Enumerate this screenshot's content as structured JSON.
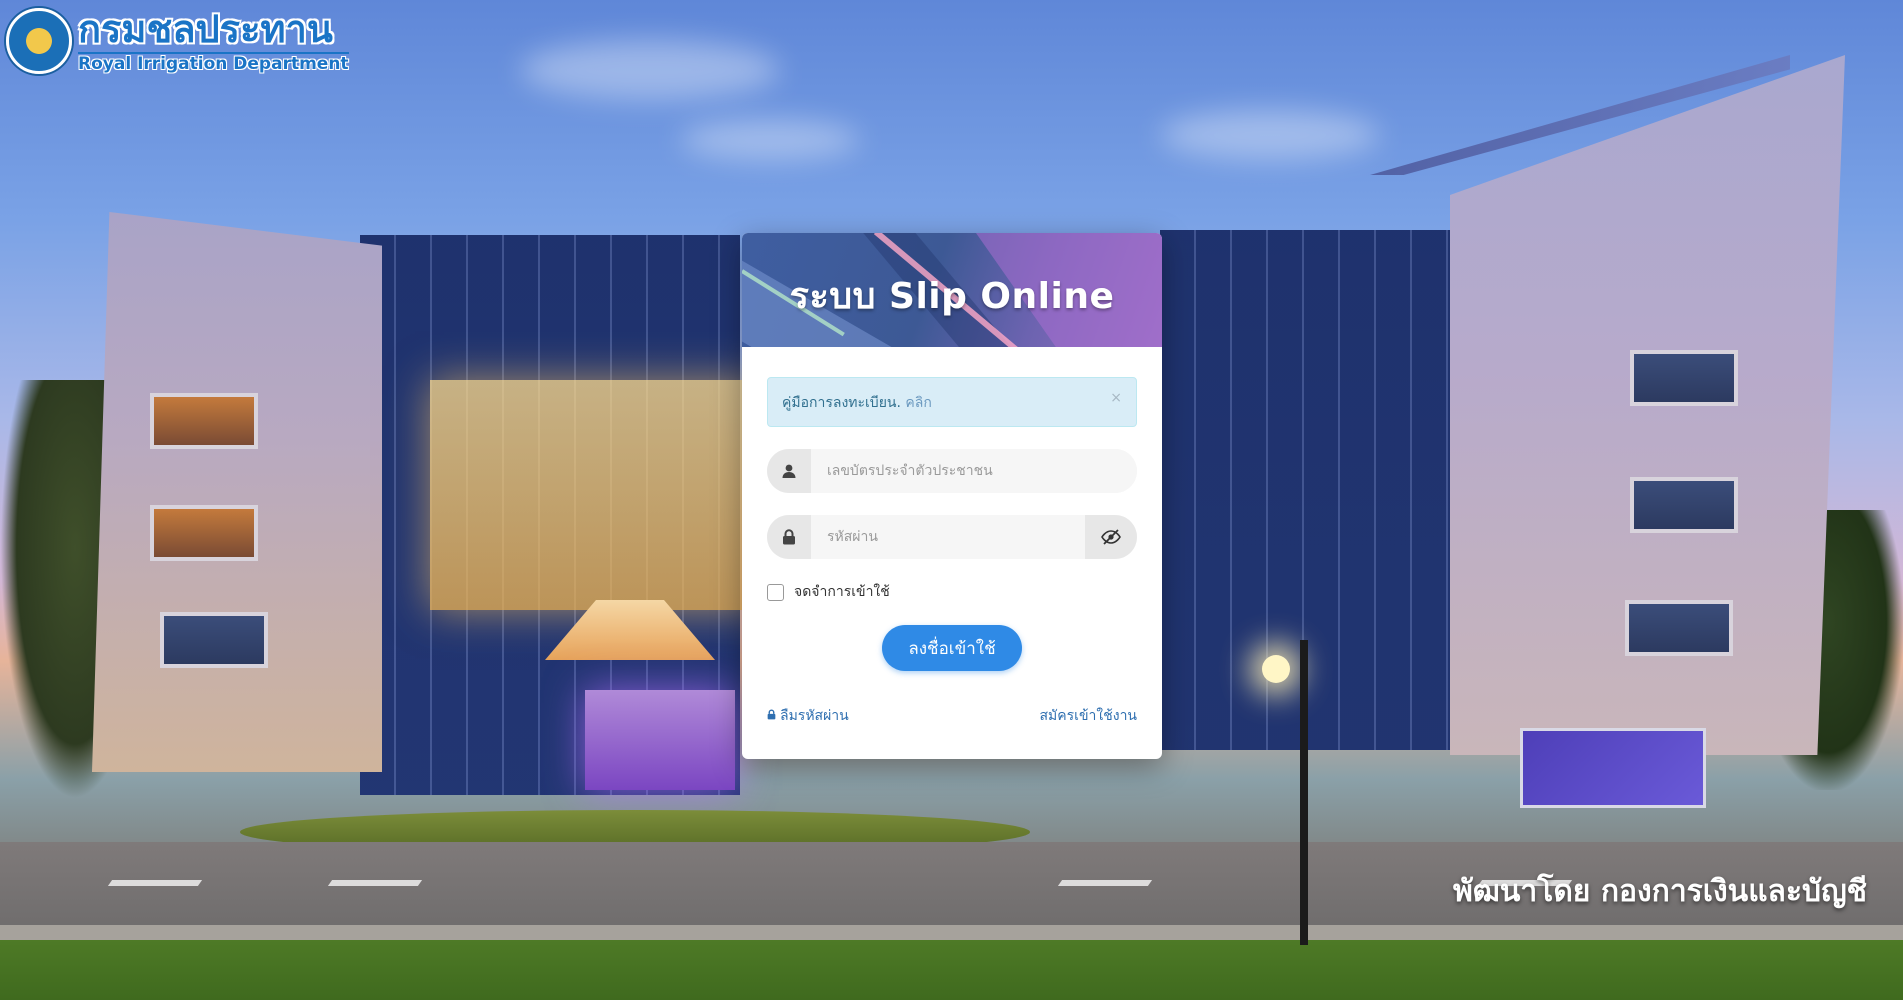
{
  "branding": {
    "org_name_th": "กรมชลประทาน",
    "org_name_en": "Royal Irrigation Department",
    "logo_icon": "rid-seal-icon"
  },
  "login_card": {
    "title": "ระบบ Slip Online",
    "notice": {
      "text": "คู่มือการลงทะเบียน.",
      "link": "คลิก",
      "close": "×"
    },
    "id_field": {
      "placeholder": "เลขบัตรประจำตัวประชาชน",
      "value": "",
      "icon": "user-icon"
    },
    "password_field": {
      "placeholder": "รหัสผ่าน",
      "value": "",
      "icon": "lock-icon",
      "toggle_icon": "eye-slash-icon"
    },
    "remember_label": "จดจำการเข้าใช้",
    "remember_checked": false,
    "submit_label": "ลงชื่อเข้าใช้",
    "forgot_password_label": "ลืมรหัสผ่าน",
    "register_label": "สมัครเข้าใช้งาน"
  },
  "footer": {
    "credit": "พัฒนาโดย กองการเงินและบัญชี"
  },
  "colors": {
    "primary": "#2f8ae6",
    "alert_bg": "#d9edf7",
    "alert_text": "#31708f",
    "link": "#2f6fb0",
    "brand_blue": "#1a74c6"
  }
}
